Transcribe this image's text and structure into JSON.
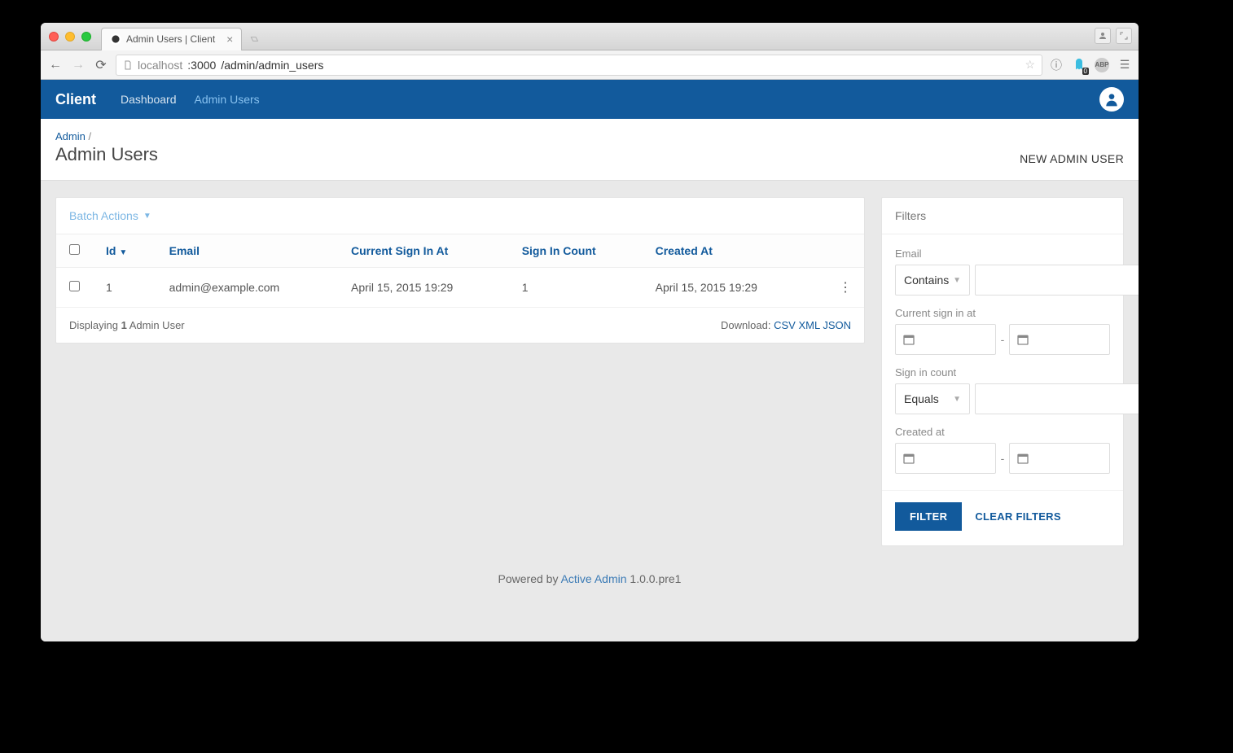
{
  "browser": {
    "tab_title": "Admin Users | Client",
    "url_host_dim": "localhost",
    "url_port": ":3000",
    "url_path": "/admin/admin_users"
  },
  "appbar": {
    "brand": "Client",
    "nav": {
      "dashboard": "Dashboard",
      "admin_users": "Admin Users"
    }
  },
  "page_header": {
    "breadcrumb_root": "Admin",
    "breadcrumb_sep": " /",
    "title": "Admin Users",
    "action": "NEW ADMIN USER"
  },
  "batch_actions_label": "Batch Actions",
  "table": {
    "headers": {
      "id": "Id",
      "email": "Email",
      "current_sign_in_at": "Current Sign In At",
      "sign_in_count": "Sign In Count",
      "created_at": "Created At"
    },
    "rows": [
      {
        "id": "1",
        "email": "admin@example.com",
        "current_sign_in_at": "April 15, 2015 19:29",
        "sign_in_count": "1",
        "created_at": "April 15, 2015 19:29"
      }
    ],
    "footer": {
      "displaying_pre": "Displaying ",
      "count": "1",
      "displaying_post": " Admin User",
      "download_label": "Download: ",
      "csv": "CSV",
      "xml": "XML",
      "json": "JSON"
    }
  },
  "filters": {
    "title": "Filters",
    "email_label": "Email",
    "email_op": "Contains",
    "current_sign_in_label": "Current sign in at",
    "sign_in_count_label": "Sign in count",
    "sign_in_count_op": "Equals",
    "created_at_label": "Created at",
    "filter_btn": "FILTER",
    "clear_btn": "CLEAR FILTERS"
  },
  "footer": {
    "pre": "Powered by ",
    "link": "Active Admin",
    "post": " 1.0.0.pre1"
  }
}
